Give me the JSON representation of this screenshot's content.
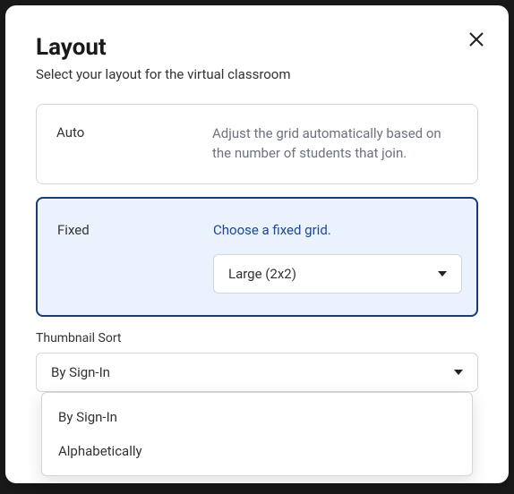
{
  "modal": {
    "title": "Layout",
    "subtitle": "Select your layout for the virtual classroom"
  },
  "options": {
    "auto": {
      "label": "Auto",
      "description": "Adjust the grid automatically based on the number of students that join."
    },
    "fixed": {
      "label": "Fixed",
      "description": "Choose a fixed grid.",
      "grid_selected": "Large (2x2)"
    }
  },
  "thumbnail_sort": {
    "label": "Thumbnail Sort",
    "selected": "By Sign-In",
    "options": [
      "By Sign-In",
      "Alphabetically"
    ]
  }
}
